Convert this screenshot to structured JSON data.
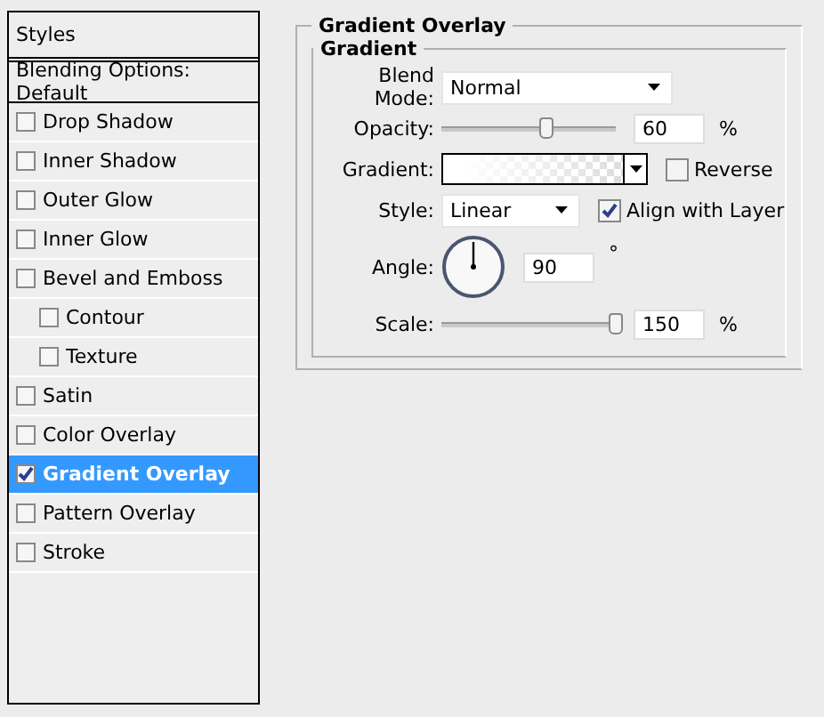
{
  "styles_panel": {
    "header": "Styles",
    "blending_options": "Blending Options: Default",
    "items": [
      {
        "label": "Drop Shadow",
        "checked": false,
        "selected": false
      },
      {
        "label": "Inner Shadow",
        "checked": false,
        "selected": false
      },
      {
        "label": "Outer Glow",
        "checked": false,
        "selected": false
      },
      {
        "label": "Inner Glow",
        "checked": false,
        "selected": false
      },
      {
        "label": "Bevel and Emboss",
        "checked": false,
        "selected": false,
        "children": [
          {
            "label": "Contour",
            "checked": false,
            "selected": false
          },
          {
            "label": "Texture",
            "checked": false,
            "selected": false
          }
        ]
      },
      {
        "label": "Satin",
        "checked": false,
        "selected": false
      },
      {
        "label": "Color Overlay",
        "checked": false,
        "selected": false
      },
      {
        "label": "Gradient Overlay",
        "checked": true,
        "selected": true
      },
      {
        "label": "Pattern Overlay",
        "checked": false,
        "selected": false
      },
      {
        "label": "Stroke",
        "checked": false,
        "selected": false
      }
    ]
  },
  "gradient_overlay": {
    "title": "Gradient Overlay",
    "group_title": "Gradient",
    "blend_mode": {
      "label": "Blend Mode:",
      "value": "Normal"
    },
    "opacity": {
      "label": "Opacity:",
      "level": 0.6,
      "value": "60",
      "unit": "%"
    },
    "gradient": {
      "label": "Gradient:",
      "reverse": {
        "label": "Reverse",
        "checked": false
      }
    },
    "style": {
      "label": "Style:",
      "value": "Linear",
      "align": {
        "label": "Align with Layer",
        "checked": true
      }
    },
    "angle": {
      "label": "Angle:",
      "value": "90",
      "unit": "°"
    },
    "scale": {
      "label": "Scale:",
      "level": 1,
      "value": "150",
      "unit": "%"
    }
  }
}
